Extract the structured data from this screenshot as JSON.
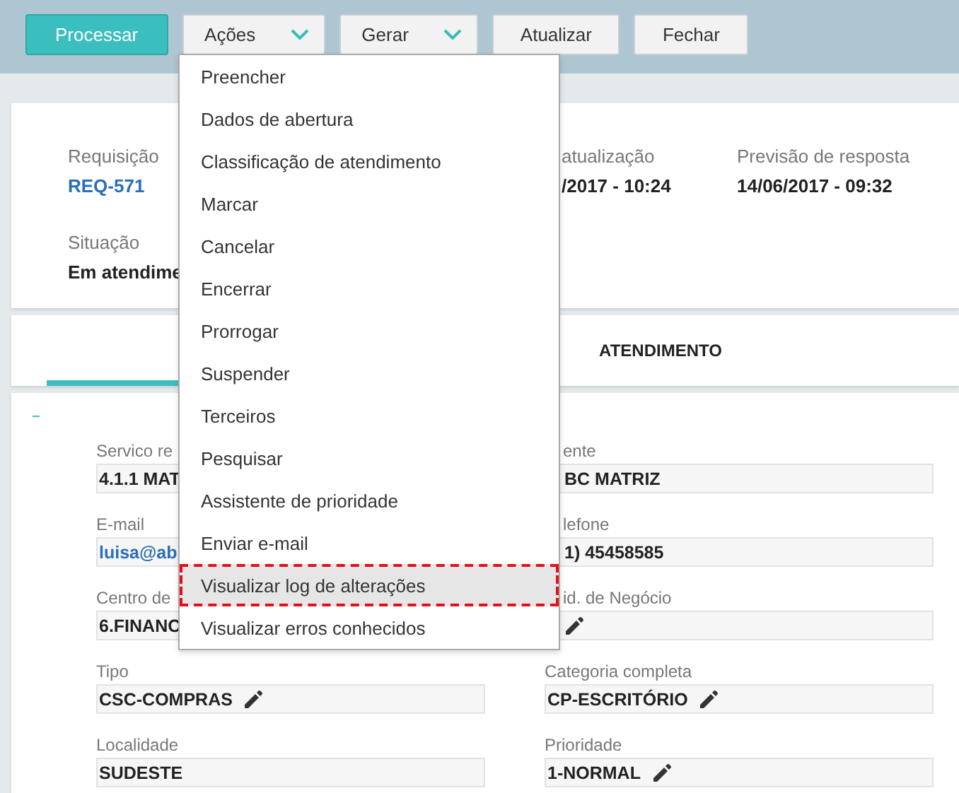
{
  "toolbar": {
    "buttons": [
      {
        "label": "Processar",
        "kind": "primary"
      },
      {
        "label": "Ações",
        "kind": "dropdown"
      },
      {
        "label": "Gerar",
        "kind": "dropdown"
      },
      {
        "label": "Atualizar",
        "kind": "plain"
      },
      {
        "label": "Fechar",
        "kind": "plain"
      }
    ]
  },
  "menu": {
    "items": [
      {
        "label": "Preencher",
        "selected": false
      },
      {
        "label": "Dados de abertura",
        "selected": false
      },
      {
        "label": "Classificação de atendimento",
        "selected": false
      },
      {
        "label": "Marcar",
        "selected": false
      },
      {
        "label": "Cancelar",
        "selected": false
      },
      {
        "label": "Encerrar",
        "selected": false
      },
      {
        "label": "Prorrogar",
        "selected": false
      },
      {
        "label": "Suspender",
        "selected": false
      },
      {
        "label": "Terceiros",
        "selected": false
      },
      {
        "label": "Pesquisar",
        "selected": false
      },
      {
        "label": "Assistente de prioridade",
        "selected": false
      },
      {
        "label": "Enviar e-mail",
        "selected": false
      },
      {
        "label": "Visualizar log de alterações",
        "selected": true
      },
      {
        "label": "Visualizar erros conhecidos",
        "selected": false
      }
    ]
  },
  "header": {
    "columns": [
      [
        {
          "label": "Requisição",
          "value": "REQ-571",
          "kind": "link"
        },
        {
          "label": "Situação",
          "value": "Em atendime",
          "kind": "text"
        }
      ],
      [
        {
          "label": "atualização",
          "value": "/2017 - 10:24",
          "kind": "text"
        }
      ],
      [
        {
          "label": "Previsão de resposta",
          "value": "14/06/2017 - 09:32",
          "kind": "text"
        }
      ]
    ]
  },
  "tabs": [
    {
      "selected": true
    },
    {
      "label": "ATENDIMENTO",
      "selected": false
    }
  ],
  "form": {
    "fields": [
      {
        "label": "Servico re",
        "value": "4.1.1 MAT",
        "kind": "text"
      },
      {
        "label": "ente",
        "value": "BC MATRIZ",
        "kind": "text",
        "editable": false
      },
      {
        "label": "E-mail",
        "value": "luisa@ab",
        "kind": "link"
      },
      {
        "label": "lefone",
        "value": "1) 45458585",
        "kind": "text",
        "editable": false
      },
      {
        "label": "Centro de",
        "value": "6.FINANC",
        "kind": "text"
      },
      {
        "label": "id. de Negócio",
        "editable": true
      },
      {
        "label": "Tipo",
        "value": "CSC-COMPRAS",
        "kind": "text",
        "editable": true
      },
      {
        "label": "Categoria completa",
        "value": "CP-ESCRITÓRIO",
        "kind": "text",
        "editable": true
      },
      {
        "label": "Localidade",
        "value": "SUDESTE",
        "kind": "text",
        "editable": false
      },
      {
        "label": "Prioridade",
        "value": "1-NORMAL",
        "kind": "text",
        "editable": true
      }
    ]
  }
}
